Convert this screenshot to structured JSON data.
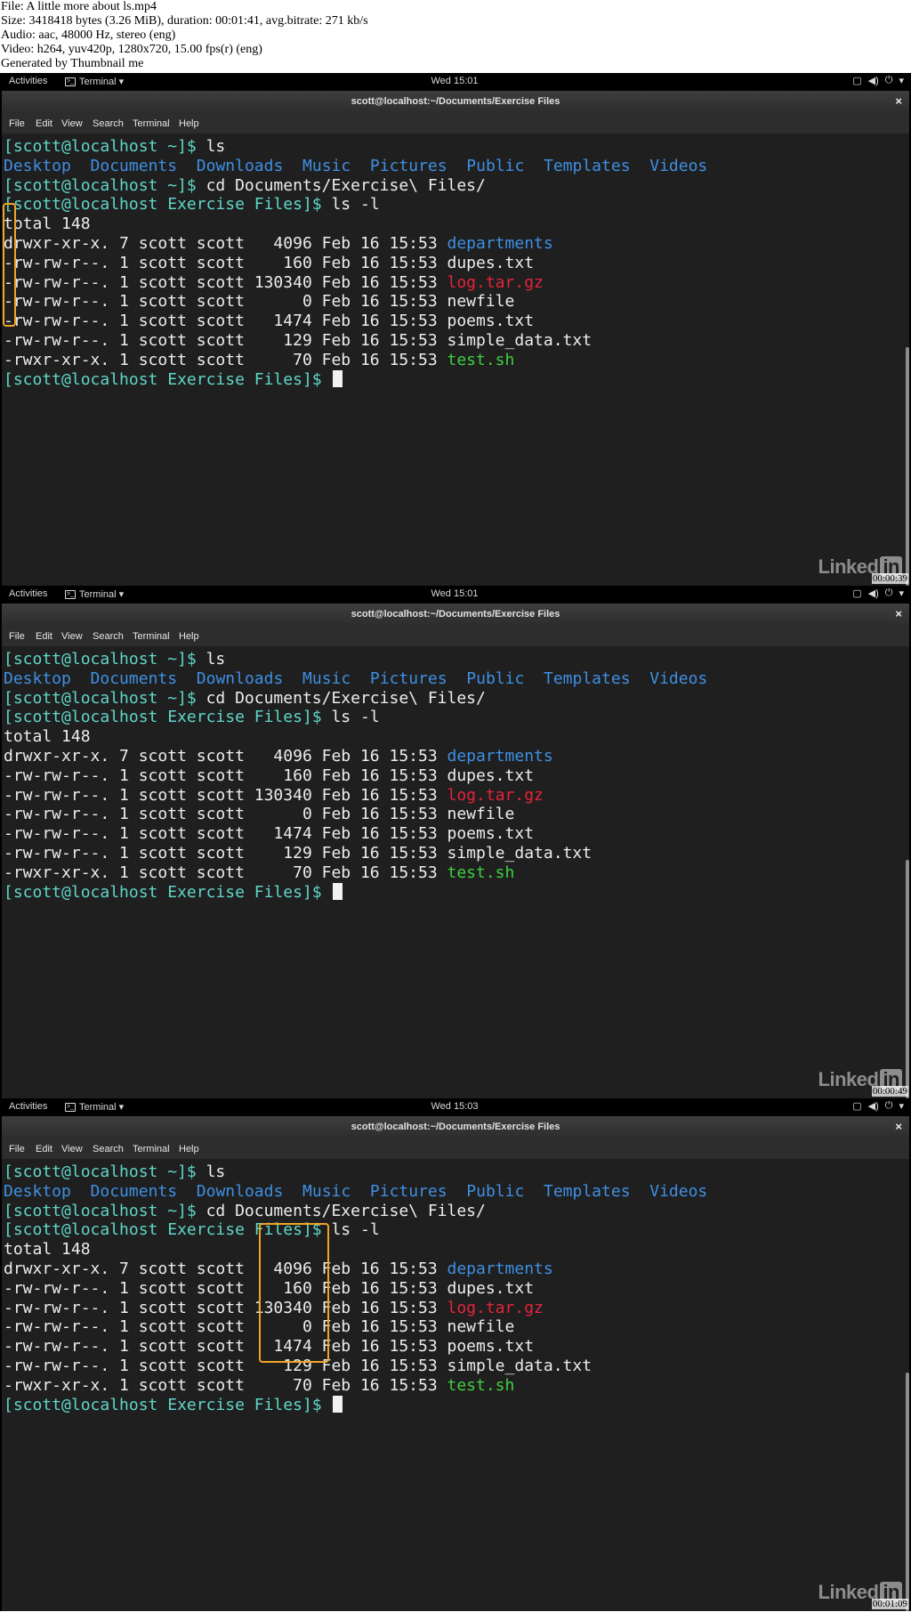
{
  "header_info": [
    "File: A little more about ls.mp4",
    "Size: 3418418 bytes (3.26 MiB), duration: 00:01:41, avg.bitrate: 271 kb/s",
    "Audio: aac, 48000 Hz, stereo (eng)",
    "Video: h264, yuv420p, 1280x720, 15.00 fps(r) (eng)",
    "Generated by Thumbnail me"
  ],
  "gnome_bar": {
    "activities": "Activities",
    "app_menu": "Terminal ▾",
    "terminal_icon": ">_",
    "icons": [
      "window-icon",
      "volume-icon",
      "power-icon",
      "menu-arrow-icon"
    ]
  },
  "window": {
    "title": "scott@localhost:~/Documents/Exercise Files",
    "close": "×",
    "menu": [
      "File",
      "Edit",
      "View",
      "Search",
      "Terminal",
      "Help"
    ]
  },
  "logo": {
    "text": "Linked",
    "box": "in"
  },
  "colors": {
    "prompt": "#5fd7c8",
    "directory": "#3f8fe3",
    "archive": "#e5243b",
    "executable": "#3ecf3e",
    "highlight": "#f0a526"
  },
  "terminal_lines": [
    [
      {
        "t": "[scott@localhost ~]$ ",
        "c": "prompt"
      },
      {
        "t": "ls",
        "c": "plain"
      }
    ],
    [
      {
        "t": "Desktop",
        "c": "dir"
      },
      {
        "t": "  ",
        "c": "plain"
      },
      {
        "t": "Documents",
        "c": "dir"
      },
      {
        "t": "  ",
        "c": "plain"
      },
      {
        "t": "Downloads",
        "c": "dir"
      },
      {
        "t": "  ",
        "c": "plain"
      },
      {
        "t": "Music",
        "c": "dir"
      },
      {
        "t": "  ",
        "c": "plain"
      },
      {
        "t": "Pictures",
        "c": "dir"
      },
      {
        "t": "  ",
        "c": "plain"
      },
      {
        "t": "Public",
        "c": "dir"
      },
      {
        "t": "  ",
        "c": "plain"
      },
      {
        "t": "Templates",
        "c": "dir"
      },
      {
        "t": "  ",
        "c": "plain"
      },
      {
        "t": "Videos",
        "c": "dir"
      }
    ],
    [
      {
        "t": "[scott@localhost ~]$ ",
        "c": "prompt"
      },
      {
        "t": "cd Documents/Exercise\\ Files/",
        "c": "plain"
      }
    ],
    [
      {
        "t": "[scott@localhost Exercise Files]$ ",
        "c": "prompt"
      },
      {
        "t": "ls -l",
        "c": "plain"
      }
    ],
    [
      {
        "t": "total 148",
        "c": "plain"
      }
    ],
    [
      {
        "t": "drwxr-xr-x. 7 scott scott   4096 Feb 16 15:53 ",
        "c": "plain"
      },
      {
        "t": "departments",
        "c": "dir"
      }
    ],
    [
      {
        "t": "-rw-rw-r--. 1 scott scott    160 Feb 16 15:53 dupes.txt",
        "c": "plain"
      }
    ],
    [
      {
        "t": "-rw-rw-r--. 1 scott scott 130340 Feb 16 15:53 ",
        "c": "plain"
      },
      {
        "t": "log.tar.gz",
        "c": "arch"
      }
    ],
    [
      {
        "t": "-rw-rw-r--. 1 scott scott      0 Feb 16 15:53 newfile",
        "c": "plain"
      }
    ],
    [
      {
        "t": "-rw-rw-r--. 1 scott scott   1474 Feb 16 15:53 poems.txt",
        "c": "plain"
      }
    ],
    [
      {
        "t": "-rw-rw-r--. 1 scott scott    129 Feb 16 15:53 simple_data.txt",
        "c": "plain"
      }
    ],
    [
      {
        "t": "-rwxr-xr-x. 1 scott scott     70 Feb 16 15:53 ",
        "c": "plain"
      },
      {
        "t": "test.sh",
        "c": "exec"
      }
    ],
    [
      {
        "t": "[scott@localhost Exercise Files]$ ",
        "c": "prompt"
      }
    ]
  ],
  "frames": [
    {
      "clock": "Wed 15:01",
      "timestamp": "00:00:39",
      "highlight": "file-type-column"
    },
    {
      "clock": "Wed 15:01",
      "timestamp": "00:00:49",
      "highlight": "none"
    },
    {
      "clock": "Wed 15:03",
      "timestamp": "00:01:09",
      "highlight": "size-column"
    }
  ]
}
